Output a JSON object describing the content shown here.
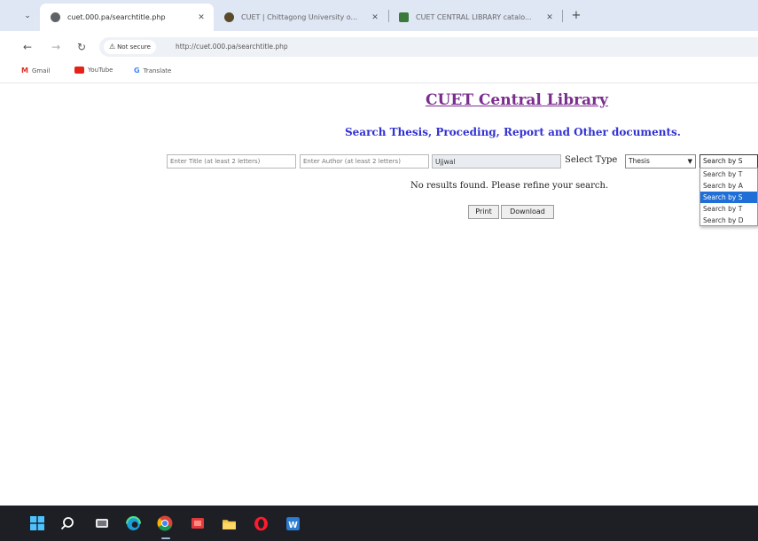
{
  "browser": {
    "tabs": [
      {
        "title": "cuet.000.pa/searchtitle.php",
        "active": true,
        "favicon_color": "#5f6368"
      },
      {
        "title": "CUET | Chittagong University o...",
        "active": false,
        "favicon_color": "#5a4a2a"
      },
      {
        "title": "CUET CENTRAL LIBRARY catalo...",
        "active": false,
        "favicon_color": "#3a7a3a"
      }
    ],
    "security_label": "Not secure",
    "url": "http://cuet.000.pa/searchtitle.php",
    "bookmarks": [
      {
        "label": "Gmail",
        "icon": "gmail-icon",
        "color": "#d93025"
      },
      {
        "label": "YouTube",
        "icon": "youtube-icon",
        "color": "#e62117"
      },
      {
        "label": "Translate",
        "icon": "translate-icon",
        "color": "#4285f4"
      }
    ]
  },
  "page": {
    "title": "CUET Central Library",
    "subtitle": "Search Thesis, Proceding, Report and Other documents.",
    "title_placeholder": "Enter Title (at least 2 letters)",
    "author_placeholder": "Enter Author (at least 2 letters)",
    "keyword_value": "Ujjwal",
    "select_type_label": "Select Type",
    "select_type_value": "Thesis",
    "search_by_value": "Search by S",
    "search_by_options": [
      "Search by T",
      "Search by A",
      "Search by S",
      "Search by T",
      "Search by D"
    ],
    "search_by_selected_index": 2,
    "no_results_text": "No results found. Please refine your search.",
    "print_label": "Print",
    "download_label": "Download"
  },
  "colors": {
    "title": "#7b2d8e",
    "subtitle": "#3131d2",
    "tab_strip": "#dfe7f5",
    "selected_option": "#1f6fd6",
    "taskbar": "#1e1f24"
  },
  "taskbar": {
    "icons": [
      "windows-start-icon",
      "search-icon",
      "task-view-icon",
      "edge-icon",
      "chrome-icon",
      "media-icon",
      "file-explorer-icon",
      "opera-icon",
      "word-icon"
    ]
  }
}
